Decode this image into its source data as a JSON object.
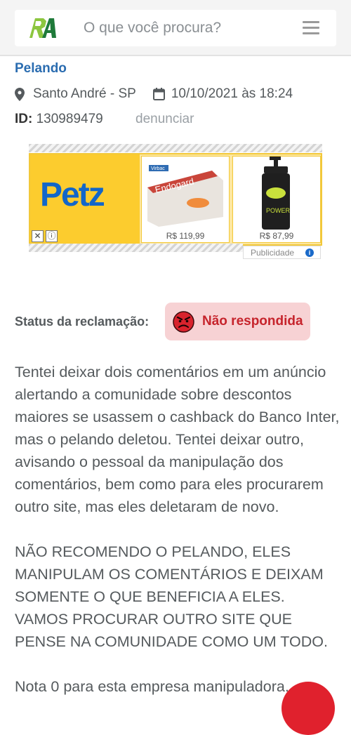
{
  "header": {
    "logo_text": "RA",
    "search_placeholder": "O que você procura?",
    "menu_icon": "hamburger-menu-icon"
  },
  "complaint_meta": {
    "company": "Pelando",
    "location": "Santo André - SP",
    "datetime": "10/10/2021 às 18:24",
    "id_label": "ID:",
    "id_value": "130989479",
    "report_link": "denunciar"
  },
  "ad": {
    "brand": "Petz",
    "products": [
      {
        "name": "Endogard",
        "price": "R$ 119,99"
      },
      {
        "name": "Power",
        "price": "R$ 87,99"
      }
    ],
    "label": "Publicidade"
  },
  "status": {
    "label": "Status da reclamação:",
    "value": "Não respondida",
    "icon": "angry-face-icon"
  },
  "complaint_text": {
    "p1": "Tentei deixar dois comentários em um anúncio alertando a comunidade sobre descontos maiores se usassem o cashback do Banco Inter, mas o pelando deletou. Tentei deixar outro, avisando o pessoal da manipulação dos comentários, bem como para eles procurarem outro site, mas eles deletaram de novo.",
    "p2": "NÃO RECOMENDO O PELANDO, ELES MANIPULAM OS COMENTÁRIOS E DEIXAM SOMENTE O QUE BENEFICIA A ELES. VAMOS PROCURAR OUTRO SITE QUE PENSE NA COMUNIDADE COMO UM TODO.",
    "p3": "Nota 0 para esta empresa manipuladora."
  },
  "colors": {
    "link_blue": "#2a6cb0",
    "status_red": "#c6242c",
    "status_bg": "#f7d2d4",
    "logo_green": "#8cc63f",
    "ad_yellow": "#fccc2e"
  }
}
